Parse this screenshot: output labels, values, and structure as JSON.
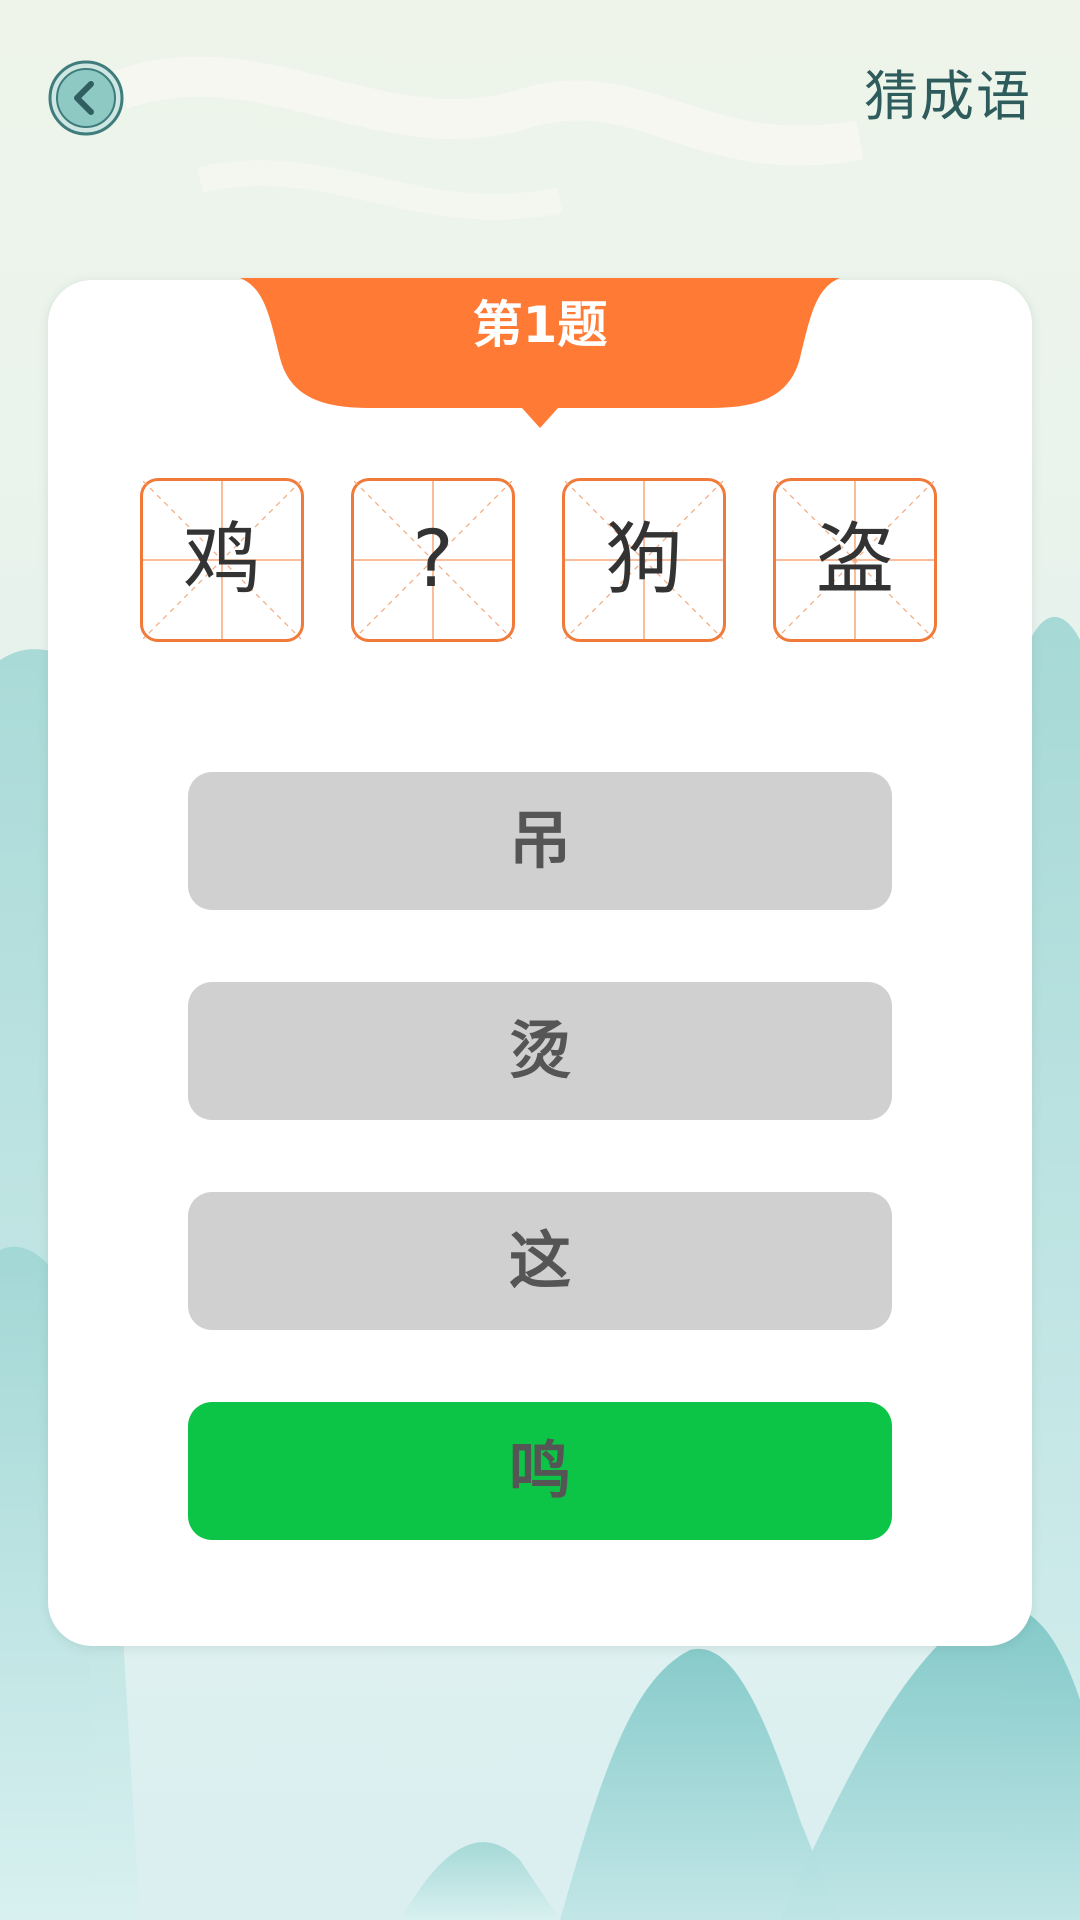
{
  "header": {
    "title": "猜成语",
    "back_icon": "chevron-left-icon"
  },
  "question": {
    "label": "第1题",
    "chars": [
      "鸡",
      "?",
      "狗",
      "盗"
    ]
  },
  "options": [
    {
      "text": "吊",
      "state": "default"
    },
    {
      "text": "烫",
      "state": "default"
    },
    {
      "text": "这",
      "state": "default"
    },
    {
      "text": "鸣",
      "state": "correct"
    }
  ],
  "colors": {
    "accent_orange": "#f07a3a",
    "ribbon_orange": "#ff7a35",
    "option_gray": "#d0d0d0",
    "option_correct_green": "#0cc546",
    "title_text": "#2e5b5b"
  }
}
